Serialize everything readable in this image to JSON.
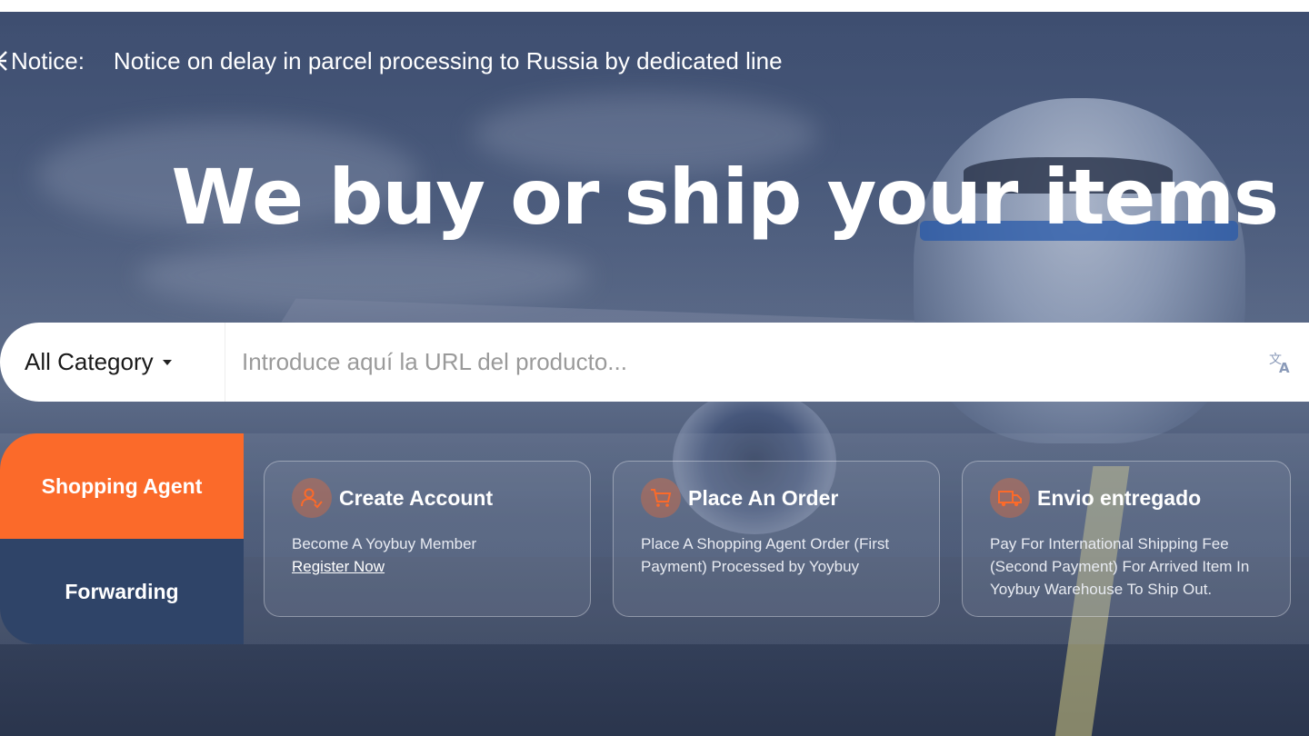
{
  "notice": {
    "label": "Notice:",
    "text": "Notice on delay in parcel processing to Russia by dedicated line"
  },
  "hero": {
    "headline": "We buy or ship your items"
  },
  "search": {
    "category": "All Category",
    "placeholder": "Introduce aquí la URL del producto..."
  },
  "tabs": [
    {
      "label": "Shopping Agent",
      "active": true
    },
    {
      "label": "Forwarding",
      "active": false
    }
  ],
  "steps": [
    {
      "icon": "user-add-icon",
      "title": "Create Account",
      "description": "Become A Yoybuy Member",
      "link": "Register Now"
    },
    {
      "icon": "cart-icon",
      "title": "Place An Order",
      "description": "Place A Shopping Agent Order (First Payment) Processed by Yoybuy"
    },
    {
      "icon": "truck-icon",
      "title": "Envio entregado",
      "description": "Pay For International Shipping Fee (Second Payment) For Arrived Item In Yoybuy Warehouse To Ship Out."
    }
  ],
  "colors": {
    "accent": "#fb6a2a",
    "tab_dark": "#2f4468"
  }
}
